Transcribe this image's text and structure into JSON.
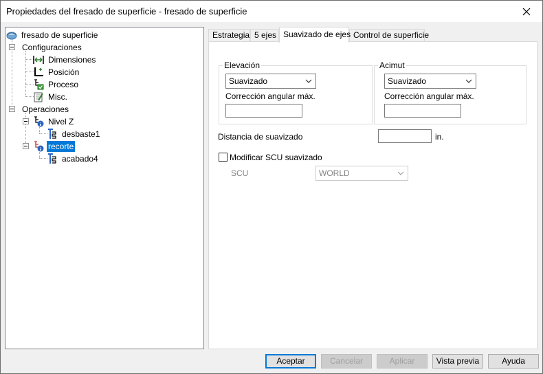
{
  "window": {
    "title": "Propiedades del fresado de superficie - fresado de superficie"
  },
  "tree": {
    "root": "fresado de superficie",
    "configuraciones": "Configuraciones",
    "dimensiones": "Dimensiones",
    "posicion": "Posición",
    "proceso": "Proceso",
    "misc": "Misc.",
    "operaciones": "Operaciones",
    "nivelz": "Nivel Z",
    "desbaste": "desbaste1",
    "recorte": "recorte",
    "acabado": "acabado4",
    "selected": "recorte"
  },
  "tabs": {
    "estrategia": "Estrategia",
    "cinco_ejes": "5 ejes",
    "suavizado": "Suavizado de ejes",
    "control": "Control de superficie",
    "active": "Suavizado de ejes"
  },
  "elevacion": {
    "title": "Elevación",
    "combo_value": "Suavizado",
    "corr_label": "Corrección angular máx.",
    "corr_value": ""
  },
  "acimut": {
    "title": "Acimut",
    "combo_value": "Suavizado",
    "corr_label": "Corrección angular máx.",
    "corr_value": ""
  },
  "distancia": {
    "label": "Distancia de suavizado",
    "value": "",
    "unit": "in."
  },
  "modificar_scu": {
    "label": "Modificar SCU suavizado",
    "checked": false
  },
  "scu": {
    "label": "SCU",
    "value": "WORLD"
  },
  "buttons": {
    "aceptar": "Aceptar",
    "cancelar": "Cancelar",
    "aplicar": "Aplicar",
    "vista_previa": "Vista previa",
    "ayuda": "Ayuda"
  },
  "colors": {
    "selection": "#0078d7",
    "tree_line": "#a0a0a0",
    "disabled_text": "#838383"
  }
}
